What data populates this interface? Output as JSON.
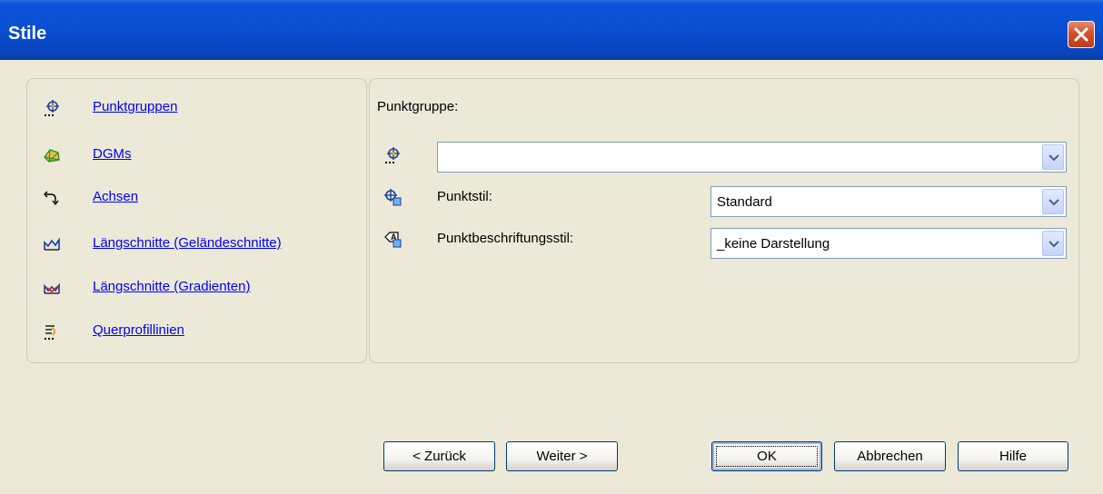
{
  "window": {
    "title": "Stile"
  },
  "sidebar": {
    "items": [
      {
        "label": "Punktgruppen",
        "icon": "point-group-icon"
      },
      {
        "label": "DGMs",
        "icon": "surface-icon"
      },
      {
        "label": "Achsen",
        "icon": "alignment-icon"
      },
      {
        "label": "Längschnitte (Geländeschnitte)",
        "icon": "profile-ground-icon"
      },
      {
        "label": "Längschnitte (Gradienten)",
        "icon": "profile-design-icon"
      },
      {
        "label": "Querprofillinien",
        "icon": "sample-line-icon"
      }
    ]
  },
  "main": {
    "heading": "Punktgruppe:",
    "point_group_value": "",
    "point_style_label": "Punktstil:",
    "point_style_value": "Standard",
    "label_style_label": "Punktbeschriftungsstil:",
    "label_style_value": "_keine Darstellung"
  },
  "buttons": {
    "back": "< Zurück",
    "next": "Weiter >",
    "ok": "OK",
    "cancel": "Abbrechen",
    "help": "Hilfe"
  },
  "colors": {
    "titlebar": "#0A4FD2",
    "link": "#0000FF",
    "dialog_bg": "#ECE9D8",
    "close_button": "#D4502E"
  }
}
